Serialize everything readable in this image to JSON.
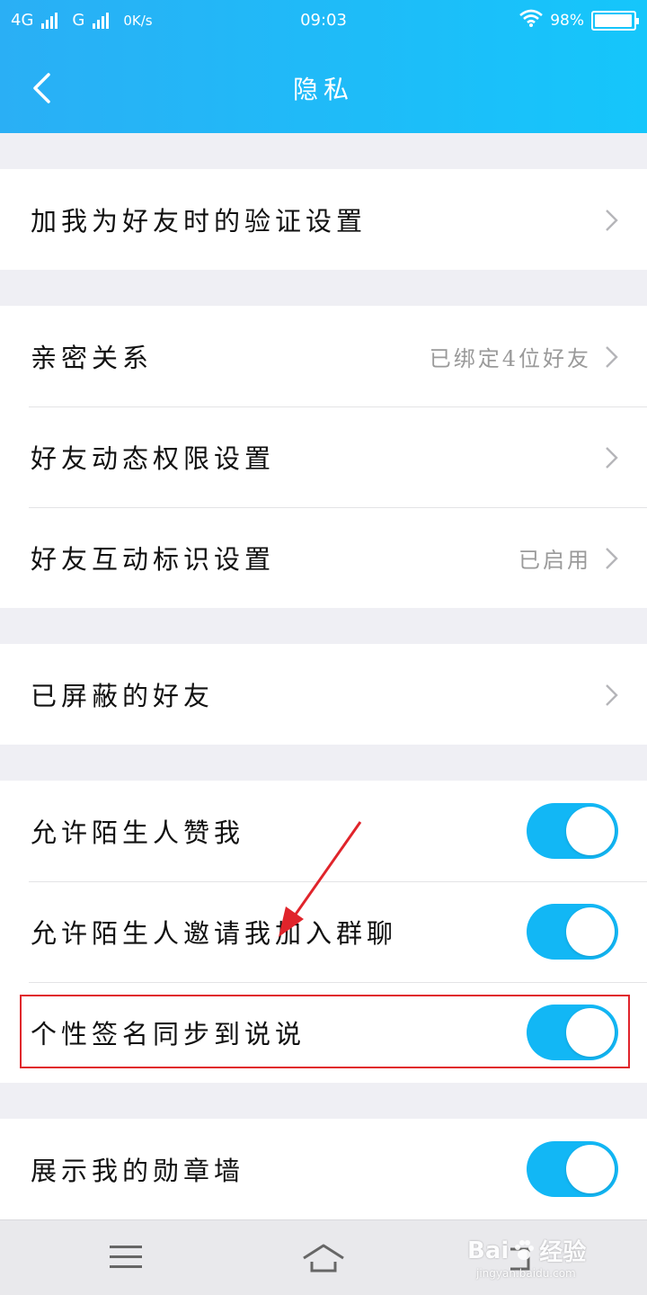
{
  "status_bar": {
    "network_1": "4G",
    "network_2": "G",
    "speed": "0K/s",
    "time": "09:03",
    "battery": "98%",
    "battery_level": 0.98
  },
  "header": {
    "title": "隐私"
  },
  "groups": [
    {
      "items": [
        {
          "label": "加我为好友时的验证设置",
          "value": ""
        }
      ]
    },
    {
      "items": [
        {
          "label": "亲密关系",
          "value": "已绑定4位好友"
        },
        {
          "label": "好友动态权限设置",
          "value": ""
        },
        {
          "label": "好友互动标识设置",
          "value": "已启用"
        }
      ]
    },
    {
      "items": [
        {
          "label": "已屏蔽的好友",
          "value": ""
        }
      ]
    },
    {
      "items": [
        {
          "label": "允许陌生人赞我",
          "on": true
        },
        {
          "label": "允许陌生人邀请我加入群聊",
          "on": true
        },
        {
          "label": "个性签名同步到说说",
          "on": true
        }
      ]
    },
    {
      "items": [
        {
          "label": "展示我的勋章墙",
          "on": true
        }
      ]
    }
  ],
  "watermark": {
    "brand": "Bai",
    "brand_suffix": "经验",
    "url": "jingyan.baidu.com"
  },
  "colors": {
    "header": "#15b8f7",
    "toggle_on": "#12b7f5",
    "annotation": "#e0242b"
  }
}
